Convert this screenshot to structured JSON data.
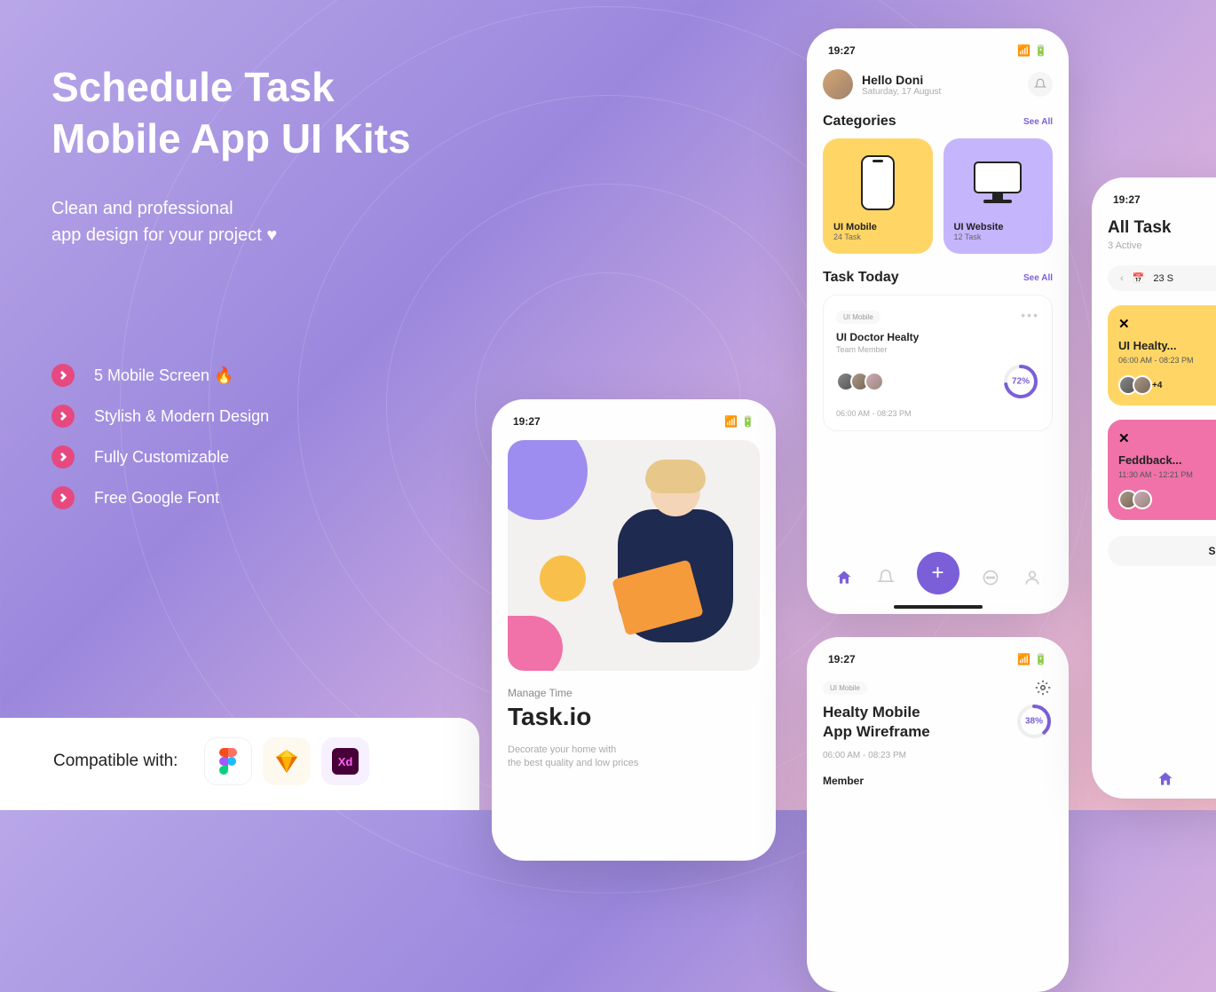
{
  "hero": {
    "title_line1": "Schedule Task",
    "title_line2": "Mobile App UI Kits",
    "subtitle_line1": "Clean and professional",
    "subtitle_line2": "app design for your project ♥"
  },
  "features": [
    "5 Mobile Screen 🔥",
    "Stylish & Modern Design",
    "Fully Customizable",
    "Free Google Font"
  ],
  "compat": {
    "label": "Compatible with:",
    "tools": [
      "Figma",
      "Sketch",
      "Xd"
    ]
  },
  "statusbar": {
    "time": "19:27"
  },
  "screen_splash": {
    "manage": "Manage Time",
    "brand": "Task.io",
    "desc_l1": "Decorate your home with",
    "desc_l2": "the best quality and low prices"
  },
  "screen_home": {
    "greeting": "Hello Doni",
    "date": "Saturday, 17 August",
    "categories_title": "Categories",
    "see_all": "See All",
    "cats": [
      {
        "name": "UI Mobile",
        "count": "24 Task"
      },
      {
        "name": "UI Website",
        "count": "12 Task"
      }
    ],
    "task_today": "Task Today",
    "task": {
      "badge": "UI Mobile",
      "name": "UI Doctor Healty",
      "sub": "Team Member",
      "progress": 72,
      "progress_label": "72%",
      "time": "06:00 AM - 08:23 PM"
    }
  },
  "screen_detail": {
    "badge": "UI Mobile",
    "title_l1": "Healty Mobile",
    "title_l2": "App Wireframe",
    "progress": 38,
    "progress_label": "38%",
    "time": "06:00 AM - 08:23 PM",
    "member": "Member"
  },
  "screen_alltask": {
    "title": "All Task",
    "active": "3 Active",
    "date_label": "23 S",
    "cards": [
      {
        "title": "UI Healty...",
        "time": "06:00 AM - 08:23 PM",
        "extra": "+4"
      },
      {
        "title": "Feddback...",
        "time": "11:30 AM - 12:21 PM"
      }
    ],
    "show": "Show"
  }
}
